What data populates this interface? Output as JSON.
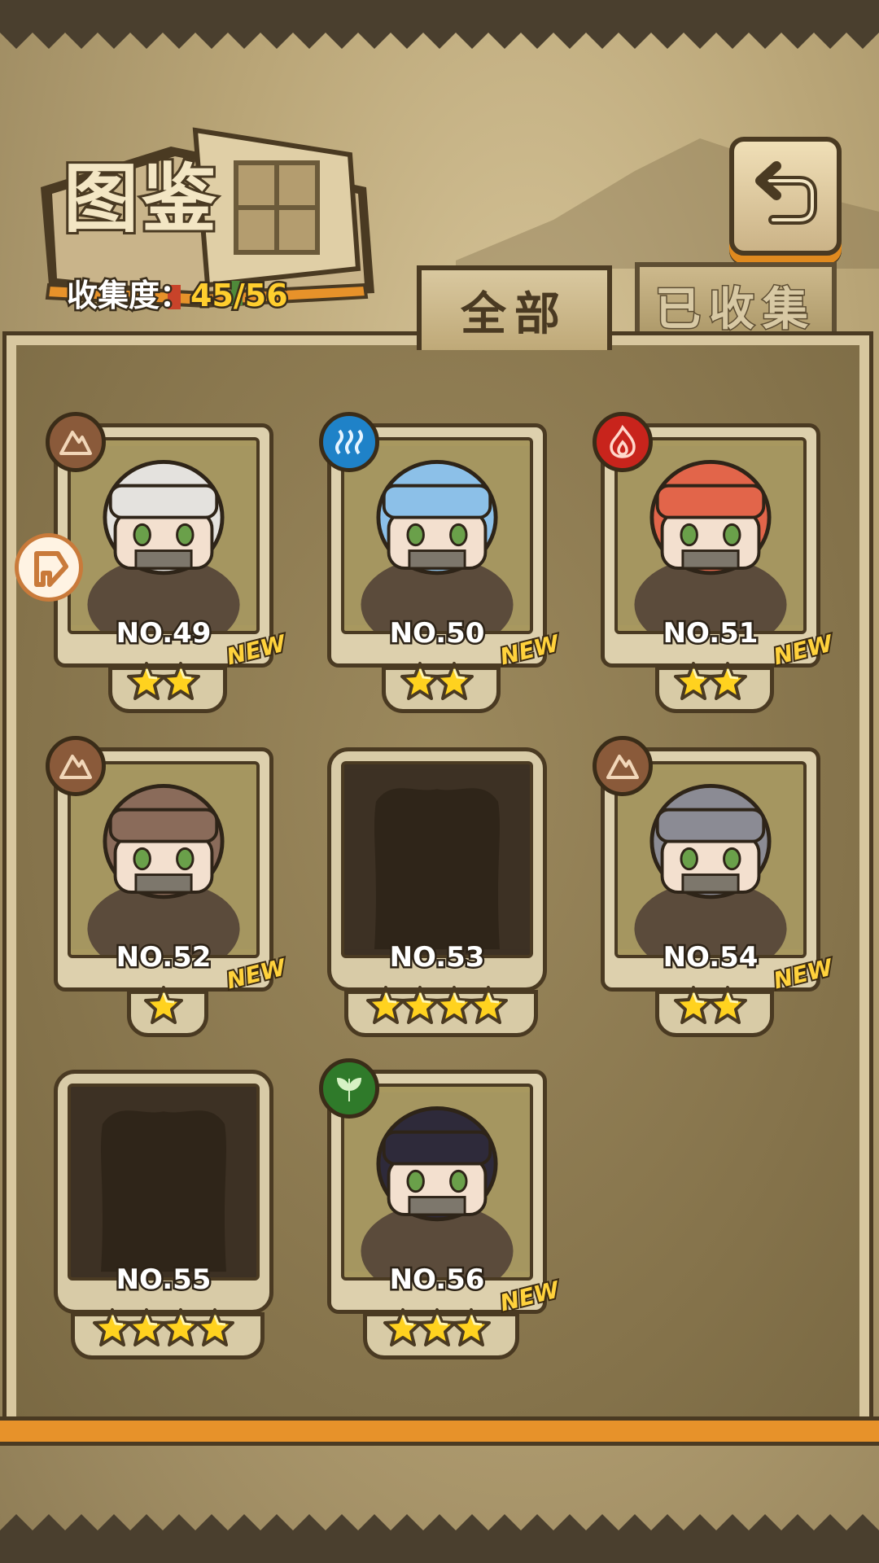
{
  "header": {
    "title": "图鉴",
    "collection_label": "收集度：",
    "collection_value": "45/56"
  },
  "tabs": [
    {
      "label": "全部",
      "active": true
    },
    {
      "label": "已收集",
      "active": false
    }
  ],
  "back_button": {
    "icon": "return-arrow-icon"
  },
  "colors": {
    "accent_orange": "#e7922a",
    "dark_brown": "#4a3a22",
    "parchment": "#ddd0ad",
    "gold": "#ffce2e"
  },
  "cards": [
    {
      "number": "NO.49",
      "stars": 2,
      "new": "NEW",
      "element": "earth",
      "collected": true,
      "hair": "#e4e2de"
    },
    {
      "number": "NO.50",
      "stars": 2,
      "new": "NEW",
      "element": "water",
      "collected": true,
      "hair": "#8cc0e8"
    },
    {
      "number": "NO.51",
      "stars": 2,
      "new": "NEW",
      "element": "fire",
      "collected": true,
      "hair": "#e2654a"
    },
    {
      "number": "NO.52",
      "stars": 1,
      "new": "NEW",
      "element": "earth",
      "collected": true,
      "hair": "#8a6b5a"
    },
    {
      "number": "NO.53",
      "stars": 4,
      "new": "",
      "element": "",
      "collected": false,
      "hair": ""
    },
    {
      "number": "NO.54",
      "stars": 2,
      "new": "NEW",
      "element": "earth",
      "collected": true,
      "hair": "#8b8b94"
    },
    {
      "number": "NO.55",
      "stars": 4,
      "new": "",
      "element": "",
      "collected": false,
      "hair": ""
    },
    {
      "number": "NO.56",
      "stars": 3,
      "new": "NEW",
      "element": "wood",
      "collected": true,
      "hair": "#2e2a3a"
    }
  ]
}
